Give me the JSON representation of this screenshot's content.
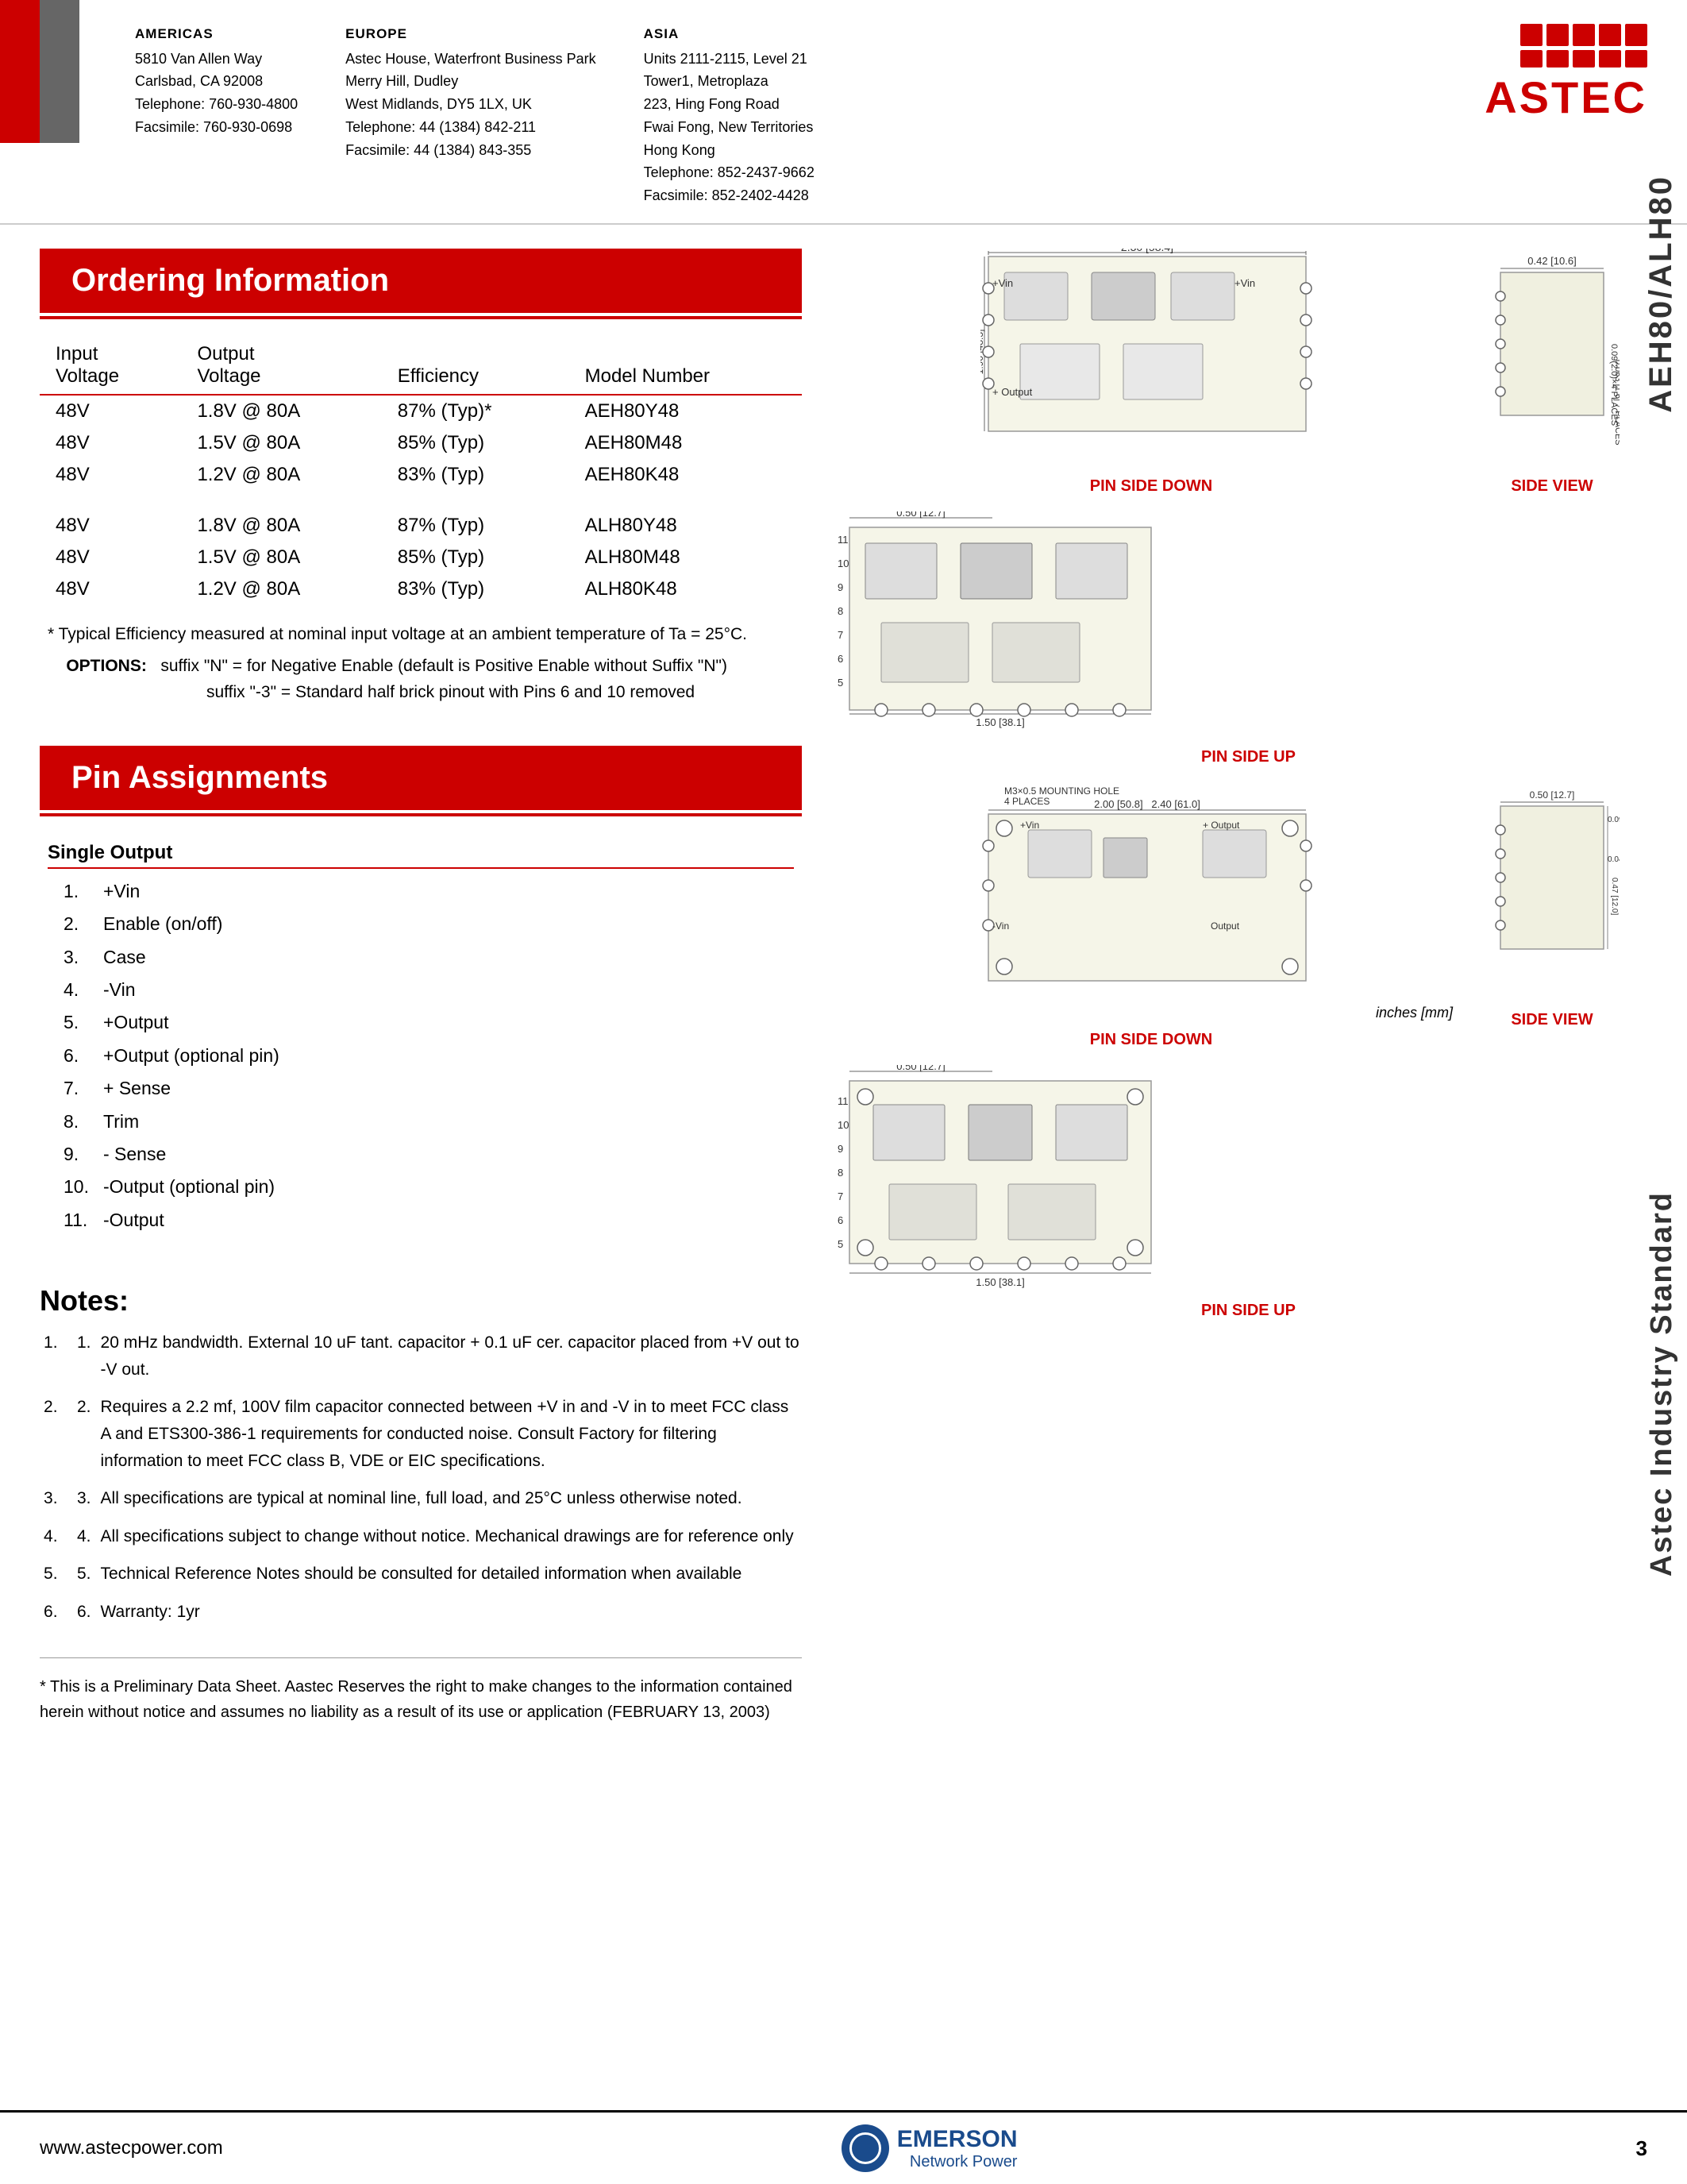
{
  "page": {
    "title": "AEH80/ALH80",
    "side_label_top": "AEH80/ALH80",
    "side_label_bottom": "Astec Industry Standard"
  },
  "header": {
    "regions": [
      {
        "name": "AMERICAS",
        "lines": [
          "5810 Van Allen Way",
          "Carlsbad, CA 92008",
          "Telephone: 760-930-4800",
          "Facsimile: 760-930-0698"
        ]
      },
      {
        "name": "EUROPE",
        "lines": [
          "Astec House, Waterfront Business Park",
          "Merry Hill, Dudley",
          "West Midlands, DY5 1LX, UK",
          "Telephone: 44 (1384) 842-211",
          "Facsimile: 44 (1384) 843-355"
        ]
      },
      {
        "name": "ASIA",
        "lines": [
          "Units 2111-2115, Level 21",
          "Tower 1, Metroplaza",
          "223, Hing Fong Road",
          "Fwai Fong, New Territories",
          "Hong Kong",
          "Telephone: 852-2437-9662",
          "Facsimile: 852-2402-4428"
        ]
      }
    ]
  },
  "ordering": {
    "section_title": "Ordering Information",
    "columns": [
      "Input\nVoltage",
      "Output\nVoltage",
      "Efficiency",
      "Model Number"
    ],
    "rows": [
      {
        "input": "48V",
        "output": "1.8V @ 80A",
        "efficiency": "87% (Typ)*",
        "model": "AEH80Y48"
      },
      {
        "input": "48V",
        "output": "1.5V @ 80A",
        "efficiency": "85% (Typ)",
        "model": "AEH80M48"
      },
      {
        "input": "48V",
        "output": "1.2V @ 80A",
        "efficiency": "83% (Typ)",
        "model": "AEH80K48"
      },
      {
        "input": "",
        "output": "",
        "efficiency": "",
        "model": ""
      },
      {
        "input": "48V",
        "output": "1.8V @ 80A",
        "efficiency": "87% (Typ)",
        "model": "ALH80Y48"
      },
      {
        "input": "48V",
        "output": "1.5V @ 80A",
        "efficiency": "85% (Typ)",
        "model": "ALH80M48"
      },
      {
        "input": "48V",
        "output": "1.2V @ 80A",
        "efficiency": "83% (Typ)",
        "model": "ALH80K48"
      }
    ],
    "footnote_star": "* Typical Efficiency measured at nominal input voltage at an ambient temperature of Ta = 25°C.",
    "options_label": "OPTIONS:",
    "option1": "suffix \"N\" = for Negative Enable (default is Positive Enable without Suffix \"N\")",
    "option2": "suffix \"-3\" = Standard half brick pinout with Pins 6 and 10 removed"
  },
  "pin_assignments": {
    "section_title": "Pin Assignments",
    "subheader": "Single Output",
    "pins": [
      {
        "num": "1.",
        "label": "+Vin"
      },
      {
        "num": "2.",
        "label": "Enable (on/off)"
      },
      {
        "num": "3.",
        "label": "Case"
      },
      {
        "num": "4.",
        "label": "-Vin"
      },
      {
        "num": "5.",
        "label": "+Output"
      },
      {
        "num": "6.",
        "label": "+Output (optional pin)"
      },
      {
        "num": "7.",
        "label": "+ Sense"
      },
      {
        "num": "8.",
        "label": "Trim"
      },
      {
        "num": "9.",
        "label": "- Sense"
      },
      {
        "num": "10.",
        "label": "-Output (optional pin)"
      },
      {
        "num": "11.",
        "label": "-Output"
      }
    ]
  },
  "notes": {
    "title": "Notes:",
    "items": [
      "20 mHz bandwidth. External 10 uF tant. capacitor + 0.1 uF cer. capacitor placed from +V out to -V out.",
      "Requires a 2.2 mf, 100V film capacitor connected between +V in and -V in to meet FCC class A and ETS300-386-1 requirements for conducted noise. Consult Factory for filtering information to meet FCC class B, VDE or EIC specifications.",
      "All specifications are typical at nominal line, full load, and 25°C unless otherwise noted.",
      "All specifications subject to change without notice. Mechanical drawings are for reference only",
      "Technical Reference Notes should be consulted for detailed information when available",
      "Warranty: 1yr"
    ],
    "disclaimer": "* This is a Preliminary Data Sheet. Aastec Reserves the right to make changes to the information contained herein without notice and assumes no liability as a result of its use or application (FEBRUARY 13, 2003)"
  },
  "diagrams": {
    "top_row": {
      "left_label": "PIN SIDE DOWN",
      "right_label": "SIDE VIEW"
    },
    "middle_label": "PIN SIDE UP",
    "bottom_row": {
      "left_label": "PIN SIDE DOWN",
      "right_label": "SIDE VIEW"
    },
    "bottom2_label": "PIN SIDE UP",
    "inches_mm": "inches [mm]"
  },
  "footer": {
    "url": "www.astecpower.com",
    "company": "EMERSON",
    "division": "Network Power",
    "page": "3"
  }
}
